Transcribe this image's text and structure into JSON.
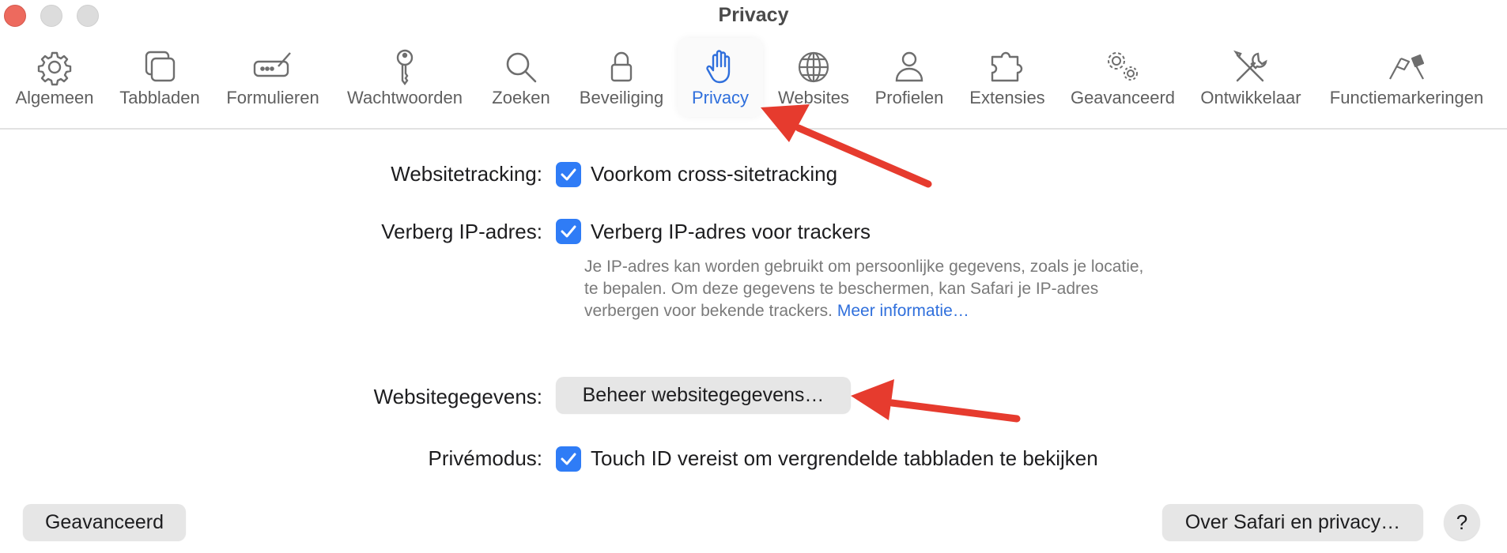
{
  "window": {
    "title": "Privacy"
  },
  "toolbar": {
    "tabs": [
      {
        "label": "Algemeen",
        "icon": "gear-icon"
      },
      {
        "label": "Tabbladen",
        "icon": "tabs-icon"
      },
      {
        "label": "Formulieren",
        "icon": "autofill-icon"
      },
      {
        "label": "Wachtwoorden",
        "icon": "key-icon"
      },
      {
        "label": "Zoeken",
        "icon": "search-icon"
      },
      {
        "label": "Beveiliging",
        "icon": "lock-icon"
      },
      {
        "label": "Privacy",
        "icon": "hand-icon",
        "active": true
      },
      {
        "label": "Websites",
        "icon": "globe-icon"
      },
      {
        "label": "Profielen",
        "icon": "person-icon"
      },
      {
        "label": "Extensies",
        "icon": "puzzle-icon"
      },
      {
        "label": "Geavanceerd",
        "icon": "gears-icon"
      },
      {
        "label": "Ontwikkelaar",
        "icon": "tools-icon"
      },
      {
        "label": "Functiemarkeringen",
        "icon": "flags-icon"
      }
    ]
  },
  "settings": {
    "tracking": {
      "label": "Websitetracking:",
      "checkbox_label": "Voorkom cross-sitetracking",
      "checked": true
    },
    "hide_ip": {
      "label": "Verberg IP-adres:",
      "checkbox_label": "Verberg IP-adres voor trackers",
      "checked": true,
      "description": "Je IP-adres kan worden gebruikt om persoonlijke gegevens, zoals je locatie, te bepalen. Om deze gegevens te beschermen, kan Safari je IP-adres verbergen voor bekende trackers.",
      "link": "Meer informatie…"
    },
    "website_data": {
      "label": "Websitegegevens:",
      "button": "Beheer websitegegevens…"
    },
    "private_mode": {
      "label": "Privémodus:",
      "checkbox_label": "Touch ID vereist om vergrendelde tabbladen te bekijken",
      "checked": true
    }
  },
  "footer": {
    "advanced_button": "Geavanceerd",
    "about_button": "Over Safari en privacy…",
    "help_button": "?"
  },
  "colors": {
    "accent": "#2f7cf6",
    "annotation_arrow": "#e63b2e"
  }
}
